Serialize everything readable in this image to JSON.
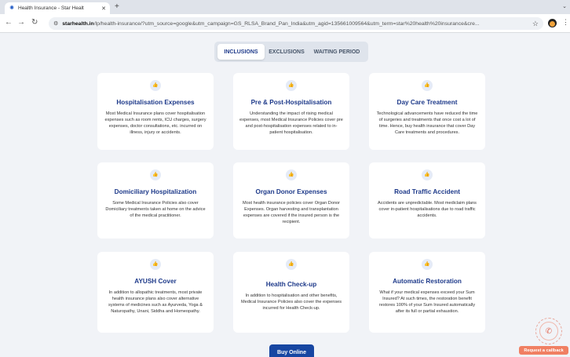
{
  "browser": {
    "tab_title": "Health Insurance - Star Healt",
    "url_host": "starhealth.in",
    "url_path": "/lp/health-insurance/?utm_source=google&utm_campaign=GS_RLSA_Brand_Pan_India&utm_agid=135661009564&utm_term=star%20health%20insurance&cre..."
  },
  "tabs": [
    {
      "label": "INCLUSIONS",
      "active": true
    },
    {
      "label": "EXCLUSIONS",
      "active": false
    },
    {
      "label": "WAITING PERIOD",
      "active": false
    }
  ],
  "cards": [
    {
      "title": "Hospitalisation Expenses",
      "text": "Most Medical Insurance plans cover hospitalisation expenses such as room rents, ICU charges, surgery expenses, doctor consultations, etc. incurred on illness, injury or accidents."
    },
    {
      "title": "Pre & Post-Hospitalisation",
      "text": "Understanding the impact of rising medical expenses, most Medical Insurance Policies cover pre and post-hospitalisation expenses related to in-patient hospitalisation."
    },
    {
      "title": "Day Care Treatment",
      "text": "Technological advancements have reduced the time of surgeries and treatments that once cost a lot of time. Hence, buy health insurance that cover Day Care treatments and procedures."
    },
    {
      "title": "Domiciliary Hospitalization",
      "text": "Some Medical Insurance Policies also cover Domiciliary treatments taken at home on the advice of the medical practitioner."
    },
    {
      "title": "Organ Donor Expenses",
      "text": "Most health insurance policies cover Organ Donor Expenses. Organ harvesting and transplantation expenses are covered if the insured person is the recipient."
    },
    {
      "title": "Road Traffic Accident",
      "text": "Accidents are unpredictable. Most mediclaim plans cover in-patient hospitalisations due to road traffic accidents."
    },
    {
      "title": "AYUSH Cover",
      "text": "In addition to allopathic treatments, most private health insurance plans also cover alternative systems of medicines such as Ayurveda, Yoga & Naturopathy, Unani, Siddha and Homeopathy."
    },
    {
      "title": "Health Check-up",
      "text": "In addition to hospitalisation and other benefits, Medical Insurance Policies also cover the expenses incurred for Health Check-up."
    },
    {
      "title": "Automatic Restoration",
      "text": "What if your medical expenses exceed your Sum Insured? At such times, the restoration benefit restores 100% of your Sum Insured automatically after its full or partial exhaustion."
    }
  ],
  "buy_button": "Buy Online",
  "callback_button": "Request a callback",
  "icons": {
    "card_icon": "thumbs-up-icon",
    "callback_icon": "phone-icon"
  },
  "colors": {
    "title_blue": "#1e3a8a",
    "button_blue": "#1746a2",
    "callback_orange": "#f07f62"
  }
}
